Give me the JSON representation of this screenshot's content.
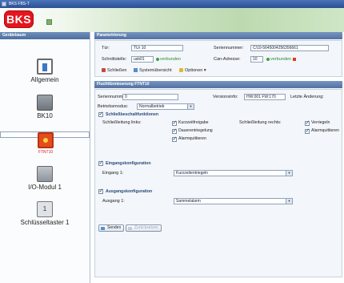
{
  "window": {
    "title": "BKS FBS-T"
  },
  "logo": {
    "text": "BKS"
  },
  "left_pane": {
    "header": "Gerätebaum",
    "devices": [
      {
        "label": "Allgemein",
        "icon": "general-settings-icon"
      },
      {
        "label": "BK10",
        "icon": "bk10-device-icon"
      },
      {
        "label": "FTNT10",
        "icon": "ftnt10-device-icon",
        "selected": true
      },
      {
        "label": "I/O-Modul 1",
        "icon": "io-module-icon"
      },
      {
        "label": "Schlüsseltaster 1",
        "icon": "key-switch-icon"
      }
    ]
  },
  "params": {
    "header": "Parametrierung",
    "tuer_label": "Tür:",
    "tuer_value": "TÜr 10",
    "seriennummer_label": "Seriennummer:",
    "seriennummer_value": "C/10-5645004256356661",
    "schnittstelle_label": "Schnittstelle:",
    "schnittstelle_value": "usb01",
    "verbunden_1": "verbunden",
    "canadresse_label": "Can-Adresse:",
    "canadresse_value": "10",
    "verbunden_2": "verbunden"
  },
  "toolbar": {
    "close_label": "Schließen",
    "overview_label": "Systemübersicht",
    "options_label": "Optionen"
  },
  "fluchttuer": {
    "header": "Fluchttürsteuerung FTNT10",
    "seriennummer_label": "Seriennummer:",
    "seriennummer_value": "0",
    "version_label": "Versionsinfo:",
    "version_value": "HW:001 FW:170",
    "letzte_label": "Letzte Änderung:",
    "betriebsmodus_label": "Betriebsmodus:",
    "betriebsmodus_value": "Normalbetrieb"
  },
  "schliess": {
    "header": "Schließbeschaltfunktionen",
    "links_label": "Schließleitung links:",
    "rechts_label": "Schließleitung rechts:",
    "opt_kurzzeit": "Kurzzeitfreigabe",
    "opt_dauer": "Dauerentriegelung",
    "opt_alarm": "Alarmquittieren",
    "opt_verriegeln": "Verriegeln",
    "opt_alarm_r": "Alarmquittieren"
  },
  "eingang": {
    "header": "Eingangskonfiguration",
    "label": "Eingang 1:",
    "value": "Kurzzeitentriegeln"
  },
  "ausgang": {
    "header": "Ausgangskonfiguration",
    "label": "Ausgang 1:",
    "value": "Sammelalarm"
  },
  "buttons": {
    "send_label": "Senden",
    "cancel_label": "Zurücksetzen"
  }
}
